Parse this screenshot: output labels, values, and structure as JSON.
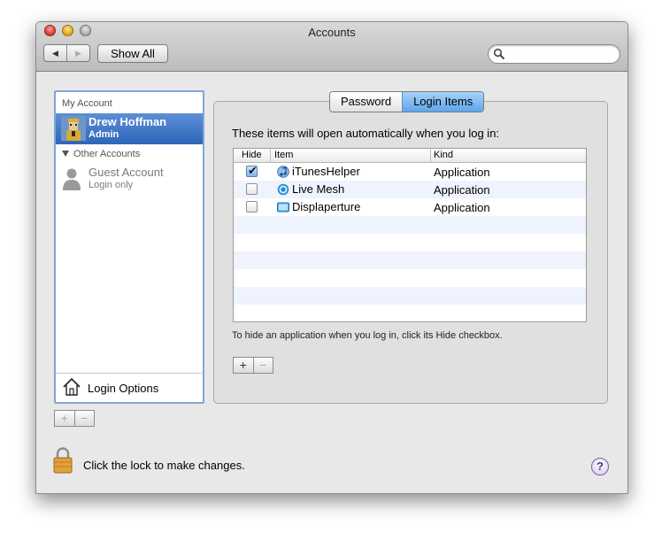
{
  "window": {
    "title": "Accounts"
  },
  "toolbar": {
    "back_glyph": "◀",
    "forward_glyph": "▶",
    "show_all_label": "Show All",
    "search_value": "",
    "search_icon": "magnifier-icon"
  },
  "sidebar": {
    "my_account_header": "My Account",
    "current_user": {
      "name": "Drew Hoffman",
      "role": "Admin"
    },
    "other_accounts_header": "Other Accounts",
    "guest": {
      "name": "Guest Account",
      "role": "Login only"
    },
    "login_options_label": "Login Options",
    "add_glyph": "+",
    "remove_glyph": "−"
  },
  "tabs": {
    "password": "Password",
    "login_items": "Login Items"
  },
  "login_items": {
    "intro": "These items will open automatically when you log in:",
    "columns": {
      "hide": "Hide",
      "item": "Item",
      "kind": "Kind"
    },
    "rows": [
      {
        "hide": true,
        "name": "iTunesHelper",
        "kind": "Application"
      },
      {
        "hide": false,
        "name": "Live Mesh",
        "kind": "Application"
      },
      {
        "hide": false,
        "name": "Displaperture",
        "kind": "Application"
      }
    ],
    "hint": "To hide an application when you log in, click its Hide checkbox.",
    "add_glyph": "+",
    "remove_glyph": "−"
  },
  "footer": {
    "lock_text": "Click the lock to make changes.",
    "help_glyph": "?"
  }
}
